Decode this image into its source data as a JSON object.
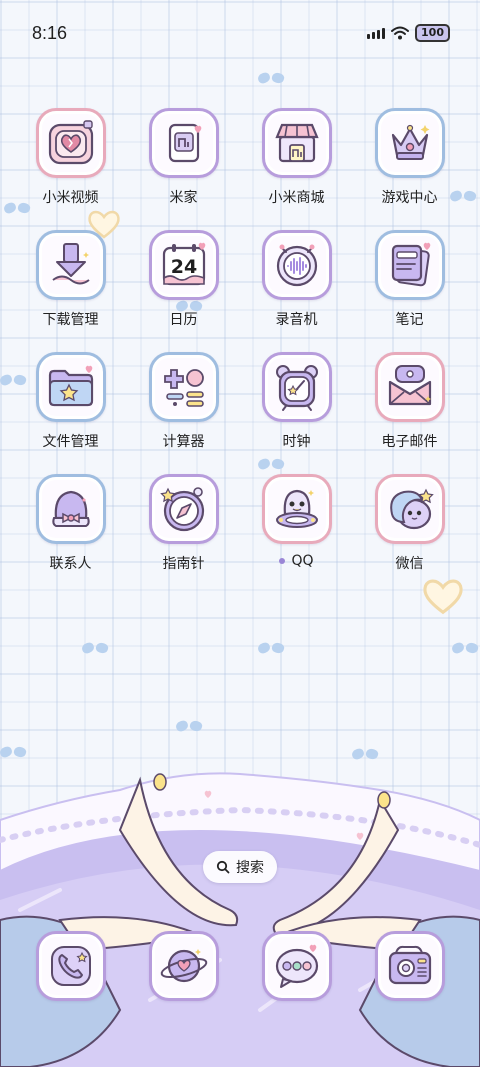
{
  "status_bar": {
    "time": "8:16",
    "battery": "100"
  },
  "apps": [
    {
      "label": "小米视频",
      "icon": "video-heart-icon"
    },
    {
      "label": "米家",
      "icon": "mijia-icon"
    },
    {
      "label": "小米商城",
      "icon": "shop-icon"
    },
    {
      "label": "游戏中心",
      "icon": "crown-icon"
    },
    {
      "label": "下载管理",
      "icon": "download-icon"
    },
    {
      "label": "日历",
      "icon": "calendar-icon",
      "day": "24"
    },
    {
      "label": "录音机",
      "icon": "recorder-icon"
    },
    {
      "label": "笔记",
      "icon": "notes-icon"
    },
    {
      "label": "文件管理",
      "icon": "folder-icon"
    },
    {
      "label": "计算器",
      "icon": "calculator-icon"
    },
    {
      "label": "时钟",
      "icon": "alarm-clock-icon"
    },
    {
      "label": "电子邮件",
      "icon": "mail-icon"
    },
    {
      "label": "联系人",
      "icon": "contacts-icon"
    },
    {
      "label": "指南针",
      "icon": "compass-icon"
    },
    {
      "label": "QQ",
      "icon": "qq-penguin-icon",
      "new_install_dot": true
    },
    {
      "label": "微信",
      "icon": "wechat-icon"
    }
  ],
  "search": {
    "label": "搜索",
    "icon": "search-icon"
  },
  "dock": [
    {
      "icon": "phone-icon"
    },
    {
      "icon": "planet-icon"
    },
    {
      "icon": "messages-icon"
    },
    {
      "icon": "camera-icon"
    }
  ],
  "colors": {
    "pink_border": "#e8aabb",
    "purple_border": "#b79ddc",
    "blue_border": "#9fbde0",
    "wallpaper_lavender": "#c9bff0"
  }
}
